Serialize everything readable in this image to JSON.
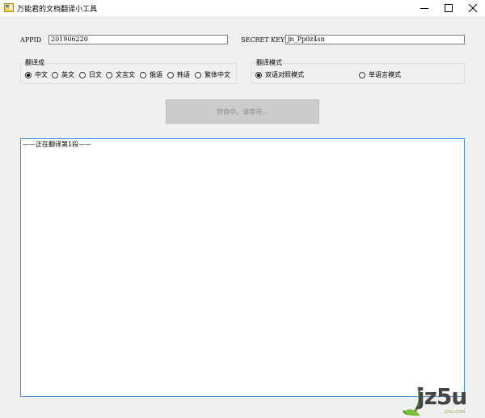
{
  "window": {
    "title": "万能君的文档翻译小工具"
  },
  "credentials": {
    "appid_label": "APPID",
    "appid_value": "201906220",
    "secret_label": "SECRET KEY",
    "secret_value": "jn_Pp0z4sn"
  },
  "translate_to": {
    "legend": "翻译成",
    "options": [
      {
        "label": "中文",
        "checked": true
      },
      {
        "label": "英文",
        "checked": false
      },
      {
        "label": "日文",
        "checked": false
      },
      {
        "label": "文言文",
        "checked": false
      },
      {
        "label": "俄语",
        "checked": false
      },
      {
        "label": "韩语",
        "checked": false
      },
      {
        "label": "繁体中文",
        "checked": false
      }
    ]
  },
  "mode": {
    "legend": "翻译模式",
    "options": [
      {
        "label": "双语对照模式",
        "checked": true
      },
      {
        "label": "单语言模式",
        "checked": false
      }
    ]
  },
  "convert_button": {
    "label": "转换中，请等待..."
  },
  "output": {
    "text": "——正在翻译第1段——"
  },
  "watermark": {
    "text": "jz5u",
    "sub": "JZ5U.COM"
  },
  "colors": {
    "accent_border": "#3a8ee6",
    "window_bg": "#f0f0f0",
    "disabled_button": "#cccccc"
  }
}
